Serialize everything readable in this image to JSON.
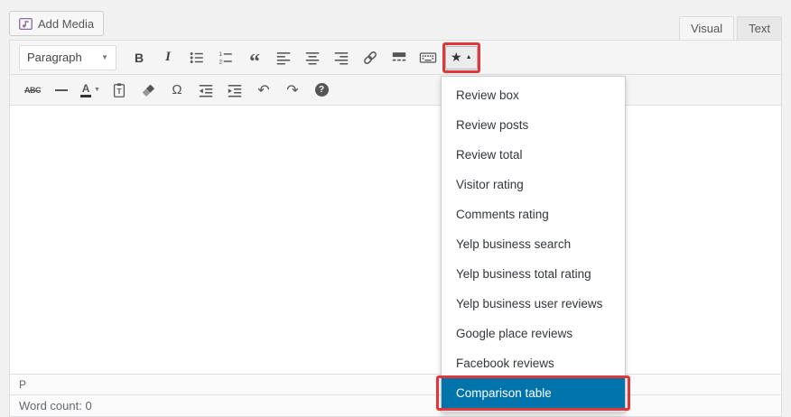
{
  "media": {
    "add_media_label": "Add Media"
  },
  "tabs": [
    {
      "label": "Visual",
      "active": true
    },
    {
      "label": "Text",
      "active": false
    }
  ],
  "toolbar": {
    "paragraph_label": "Paragraph",
    "glyphs": {
      "bold": "B",
      "italic": "I",
      "blockquote": "“",
      "strikethrough": "ABC",
      "charmap": "Ω",
      "undo": "↶",
      "redo": "↷",
      "help": "?",
      "star": "★",
      "caret_up": "▲",
      "caret_down": "▼",
      "textcolor_letter": "A"
    }
  },
  "dropdown": {
    "items": [
      {
        "label": "Review box"
      },
      {
        "label": "Review posts"
      },
      {
        "label": "Review total"
      },
      {
        "label": "Visitor rating"
      },
      {
        "label": "Comments rating"
      },
      {
        "label": "Yelp business search"
      },
      {
        "label": "Yelp business total rating"
      },
      {
        "label": "Yelp business user reviews"
      },
      {
        "label": "Google place reviews"
      },
      {
        "label": "Facebook reviews"
      },
      {
        "label": "Comparison table",
        "selected": true
      }
    ]
  },
  "statusbar": {
    "path": "P",
    "word_count": "Word count: 0"
  },
  "colors": {
    "selected_blue": "#0073aa",
    "annotation_red": "#e0383a",
    "toolbar_bg": "#f5f5f5",
    "page_bg": "#f1f1f1"
  }
}
